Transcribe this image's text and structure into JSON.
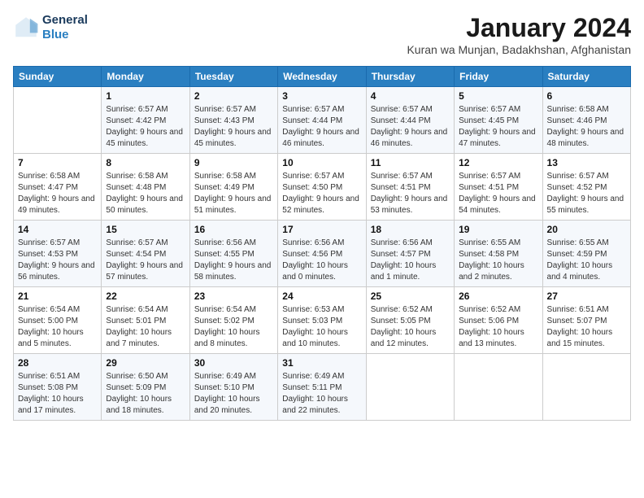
{
  "header": {
    "logo_line1": "General",
    "logo_line2": "Blue",
    "title": "January 2024",
    "subtitle": "Kuran wa Munjan, Badakhshan, Afghanistan"
  },
  "weekdays": [
    "Sunday",
    "Monday",
    "Tuesday",
    "Wednesday",
    "Thursday",
    "Friday",
    "Saturday"
  ],
  "weeks": [
    [
      {
        "day": "",
        "sunrise": "",
        "sunset": "",
        "daylight": ""
      },
      {
        "day": "1",
        "sunrise": "6:57 AM",
        "sunset": "4:42 PM",
        "daylight": "9 hours and 45 minutes."
      },
      {
        "day": "2",
        "sunrise": "6:57 AM",
        "sunset": "4:43 PM",
        "daylight": "9 hours and 45 minutes."
      },
      {
        "day": "3",
        "sunrise": "6:57 AM",
        "sunset": "4:44 PM",
        "daylight": "9 hours and 46 minutes."
      },
      {
        "day": "4",
        "sunrise": "6:57 AM",
        "sunset": "4:44 PM",
        "daylight": "9 hours and 46 minutes."
      },
      {
        "day": "5",
        "sunrise": "6:57 AM",
        "sunset": "4:45 PM",
        "daylight": "9 hours and 47 minutes."
      },
      {
        "day": "6",
        "sunrise": "6:58 AM",
        "sunset": "4:46 PM",
        "daylight": "9 hours and 48 minutes."
      }
    ],
    [
      {
        "day": "7",
        "sunrise": "6:58 AM",
        "sunset": "4:47 PM",
        "daylight": "9 hours and 49 minutes."
      },
      {
        "day": "8",
        "sunrise": "6:58 AM",
        "sunset": "4:48 PM",
        "daylight": "9 hours and 50 minutes."
      },
      {
        "day": "9",
        "sunrise": "6:58 AM",
        "sunset": "4:49 PM",
        "daylight": "9 hours and 51 minutes."
      },
      {
        "day": "10",
        "sunrise": "6:57 AM",
        "sunset": "4:50 PM",
        "daylight": "9 hours and 52 minutes."
      },
      {
        "day": "11",
        "sunrise": "6:57 AM",
        "sunset": "4:51 PM",
        "daylight": "9 hours and 53 minutes."
      },
      {
        "day": "12",
        "sunrise": "6:57 AM",
        "sunset": "4:51 PM",
        "daylight": "9 hours and 54 minutes."
      },
      {
        "day": "13",
        "sunrise": "6:57 AM",
        "sunset": "4:52 PM",
        "daylight": "9 hours and 55 minutes."
      }
    ],
    [
      {
        "day": "14",
        "sunrise": "6:57 AM",
        "sunset": "4:53 PM",
        "daylight": "9 hours and 56 minutes."
      },
      {
        "day": "15",
        "sunrise": "6:57 AM",
        "sunset": "4:54 PM",
        "daylight": "9 hours and 57 minutes."
      },
      {
        "day": "16",
        "sunrise": "6:56 AM",
        "sunset": "4:55 PM",
        "daylight": "9 hours and 58 minutes."
      },
      {
        "day": "17",
        "sunrise": "6:56 AM",
        "sunset": "4:56 PM",
        "daylight": "10 hours and 0 minutes."
      },
      {
        "day": "18",
        "sunrise": "6:56 AM",
        "sunset": "4:57 PM",
        "daylight": "10 hours and 1 minute."
      },
      {
        "day": "19",
        "sunrise": "6:55 AM",
        "sunset": "4:58 PM",
        "daylight": "10 hours and 2 minutes."
      },
      {
        "day": "20",
        "sunrise": "6:55 AM",
        "sunset": "4:59 PM",
        "daylight": "10 hours and 4 minutes."
      }
    ],
    [
      {
        "day": "21",
        "sunrise": "6:54 AM",
        "sunset": "5:00 PM",
        "daylight": "10 hours and 5 minutes."
      },
      {
        "day": "22",
        "sunrise": "6:54 AM",
        "sunset": "5:01 PM",
        "daylight": "10 hours and 7 minutes."
      },
      {
        "day": "23",
        "sunrise": "6:54 AM",
        "sunset": "5:02 PM",
        "daylight": "10 hours and 8 minutes."
      },
      {
        "day": "24",
        "sunrise": "6:53 AM",
        "sunset": "5:03 PM",
        "daylight": "10 hours and 10 minutes."
      },
      {
        "day": "25",
        "sunrise": "6:52 AM",
        "sunset": "5:05 PM",
        "daylight": "10 hours and 12 minutes."
      },
      {
        "day": "26",
        "sunrise": "6:52 AM",
        "sunset": "5:06 PM",
        "daylight": "10 hours and 13 minutes."
      },
      {
        "day": "27",
        "sunrise": "6:51 AM",
        "sunset": "5:07 PM",
        "daylight": "10 hours and 15 minutes."
      }
    ],
    [
      {
        "day": "28",
        "sunrise": "6:51 AM",
        "sunset": "5:08 PM",
        "daylight": "10 hours and 17 minutes."
      },
      {
        "day": "29",
        "sunrise": "6:50 AM",
        "sunset": "5:09 PM",
        "daylight": "10 hours and 18 minutes."
      },
      {
        "day": "30",
        "sunrise": "6:49 AM",
        "sunset": "5:10 PM",
        "daylight": "10 hours and 20 minutes."
      },
      {
        "day": "31",
        "sunrise": "6:49 AM",
        "sunset": "5:11 PM",
        "daylight": "10 hours and 22 minutes."
      },
      {
        "day": "",
        "sunrise": "",
        "sunset": "",
        "daylight": ""
      },
      {
        "day": "",
        "sunrise": "",
        "sunset": "",
        "daylight": ""
      },
      {
        "day": "",
        "sunrise": "",
        "sunset": "",
        "daylight": ""
      }
    ]
  ]
}
